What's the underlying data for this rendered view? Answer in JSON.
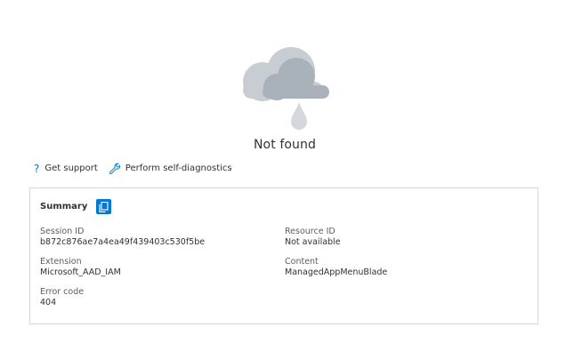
{
  "title": "Not found",
  "links": {
    "support": "Get support",
    "diagnostics": "Perform self-diagnostics"
  },
  "summary": {
    "title": "Summary",
    "fields": {
      "session_id": {
        "label": "Session ID",
        "value": "b872c876ae7a4ea49f439403c530f5be"
      },
      "resource_id": {
        "label": "Resource ID",
        "value": "Not available"
      },
      "extension": {
        "label": "Extension",
        "value": "Microsoft_AAD_IAM"
      },
      "content": {
        "label": "Content",
        "value": "ManagedAppMenuBlade"
      },
      "error_code": {
        "label": "Error code",
        "value": "404"
      }
    }
  },
  "icons": {
    "illustration": "cloud-rain-icon",
    "support": "question-icon",
    "diagnostics": "wrench-icon",
    "copy": "copy-icon"
  },
  "colors": {
    "accent": "#0078d4",
    "cloud_light": "#c8cdd3",
    "cloud_dark": "#a9b1ba",
    "drop": "#d4d8dd"
  }
}
